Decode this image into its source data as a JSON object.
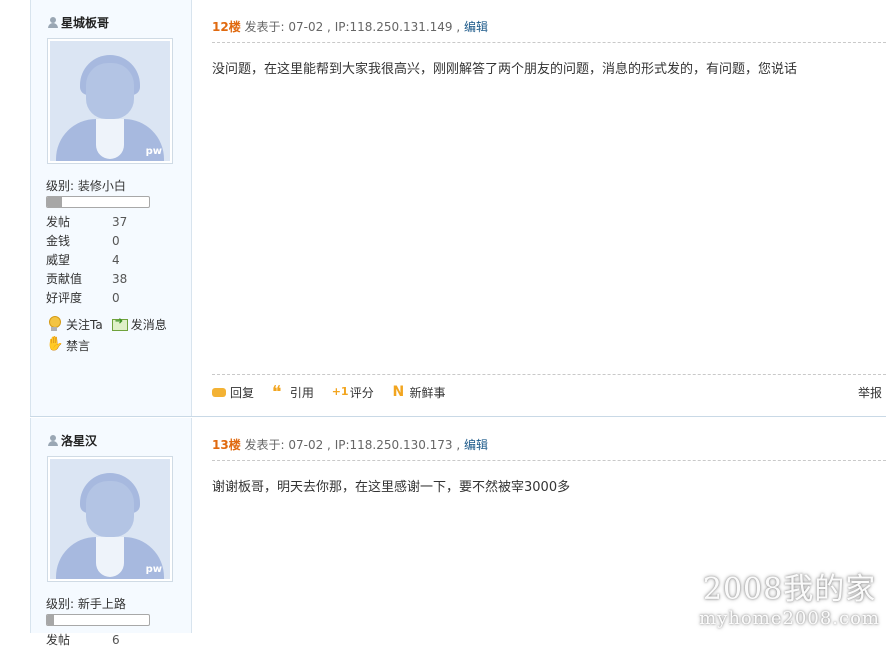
{
  "posts": [
    {
      "username": "星城板哥",
      "avatar_watermark": "pw",
      "level": "级别: 装修小白",
      "level_progress": 0.15,
      "stats": [
        {
          "label": "发帖",
          "value": "37"
        },
        {
          "label": "金钱",
          "value": "0"
        },
        {
          "label": "威望",
          "value": "4"
        },
        {
          "label": "贡献值",
          "value": "38"
        },
        {
          "label": "好评度",
          "value": "0"
        }
      ],
      "actions": {
        "follow": "关注Ta",
        "message": "发消息",
        "ban": "禁言"
      },
      "floor": "12楼",
      "meta": " 发表于: 07-02 , IP:118.250.131.149 , ",
      "edit": "编辑",
      "content": "没问题，在这里能帮到大家我很高兴，刚刚解答了两个朋友的问题，消息的形式发的，有问题，您说话",
      "footer": {
        "reply": "回复",
        "quote": "引用",
        "rate": "评分",
        "news": "新鲜事",
        "report": "举报"
      }
    },
    {
      "username": "洛星汉",
      "avatar_watermark": "pw",
      "level": "级别: 新手上路",
      "level_progress": 0.07,
      "stats": [
        {
          "label": "发帖",
          "value": "6"
        }
      ],
      "floor": "13楼",
      "meta": " 发表于: 07-02 , IP:118.250.130.173 , ",
      "edit": "编辑",
      "content": "谢谢板哥，明天去你那，在这里感谢一下，要不然被宰3000多"
    }
  ],
  "watermark": {
    "line1": "2008我的家",
    "line2": "myhome2008.com"
  }
}
